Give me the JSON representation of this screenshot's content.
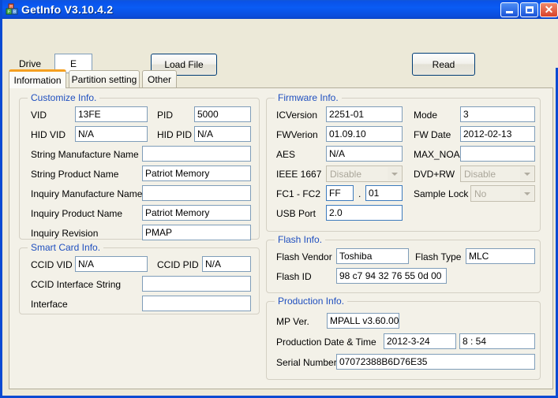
{
  "window": {
    "title": "GetInfo V3.10.4.2",
    "icon": "app-blocks-icon",
    "buttons": {
      "minimize": "minimize-icon",
      "maximize": "maximize-icon",
      "close": "close-icon"
    }
  },
  "toolbar": {
    "drive_label": "Drive",
    "drive_value": "E",
    "load_file_label": "Load File",
    "read_label": "Read"
  },
  "tabs": [
    {
      "label": "Information",
      "active": true
    },
    {
      "label": "Partition setting",
      "active": false
    },
    {
      "label": "Other",
      "active": false
    }
  ],
  "customize_info": {
    "title": "Customize Info.",
    "vid_label": "VID",
    "vid_value": "13FE",
    "pid_label": "PID",
    "pid_value": "5000",
    "hid_vid_label": "HID VID",
    "hid_vid_value": "N/A",
    "hid_pid_label": "HID PID",
    "hid_pid_value": "N/A",
    "string_manufacture_label": "String Manufacture Name",
    "string_manufacture_value": "",
    "string_product_label": "String Product Name",
    "string_product_value": "Patriot Memory",
    "inquiry_manufacture_label": "Inquiry Manufacture Name",
    "inquiry_manufacture_value": "",
    "inquiry_product_label": "Inquiry Product Name",
    "inquiry_product_value": "Patriot Memory",
    "inquiry_revision_label": "Inquiry Revision",
    "inquiry_revision_value": "PMAP"
  },
  "smart_card_info": {
    "title": "Smart Card Info.",
    "ccid_vid_label": "CCID VID",
    "ccid_vid_value": "N/A",
    "ccid_pid_label": "CCID PID",
    "ccid_pid_value": "N/A",
    "ccid_interface_string_label": "CCID Interface String",
    "ccid_interface_string_value": "",
    "interface_label": "Interface",
    "interface_value": ""
  },
  "firmware_info": {
    "title": "Firmware Info.",
    "icversion_label": "ICVersion",
    "icversion_value": "2251-01",
    "mode_label": "Mode",
    "mode_value": "3",
    "fwverion_label": "FWVerion",
    "fwverion_value": "01.09.10",
    "fw_date_label": "FW Date",
    "fw_date_value": "2012-02-13",
    "aes_label": "AES",
    "aes_value": "N/A",
    "max_noa_label": "MAX_NOA",
    "max_noa_value": "",
    "ieee_label": "IEEE 1667",
    "ieee_value": "Disable",
    "dvdrw_label": "DVD+RW",
    "dvdrw_value": "Disable",
    "fc_label": "FC1 - FC2",
    "fc1_value": "FF",
    "fc_separator": ".",
    "fc2_value": "01",
    "sample_lock_label": "Sample Lock",
    "sample_lock_value": "No",
    "usb_port_label": "USB Port",
    "usb_port_value": "2.0"
  },
  "flash_info": {
    "title": "Flash Info.",
    "flash_vendor_label": "Flash Vendor",
    "flash_vendor_value": "Toshiba",
    "flash_type_label": "Flash Type",
    "flash_type_value": "MLC",
    "flash_id_label": "Flash ID",
    "flash_id_value": "98 c7 94 32 76 55 0d 00"
  },
  "production_info": {
    "title": "Production Info.",
    "mp_ver_label": "MP Ver.",
    "mp_ver_value": "MPALL v3.60.00",
    "production_datetime_label": "Production Date & Time",
    "production_date_value": "2012-3-24",
    "production_time_value": "8 : 54",
    "serial_number_label": "Serial Number",
    "serial_number_value": "07072388B6D76E35"
  },
  "colors": {
    "titlebar_blue": "#0a5cf4",
    "group_label_blue": "#1f4fbf",
    "active_tab_accent": "#f5a020",
    "field_border": "#7f9db9",
    "panel_bg": "#f3f1e8",
    "window_bg": "#ece9d8"
  }
}
